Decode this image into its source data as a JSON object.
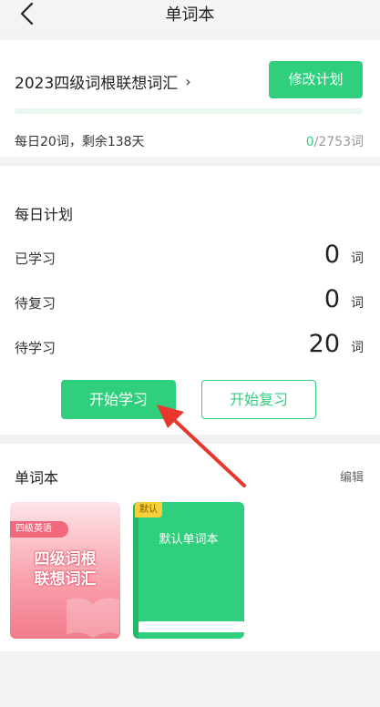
{
  "header": {
    "title": "单词本",
    "back_icon": "back-chevron-icon"
  },
  "plan": {
    "book_title": "2023四级词根联想词汇",
    "chevron": "›",
    "edit_button": "修改计划",
    "progress": 0,
    "description": "每日20词，剩余138天",
    "learned_count": "0",
    "total_count": "/2753词"
  },
  "daily": {
    "heading": "每日计划",
    "rows": [
      {
        "label": "已学习",
        "value": "0",
        "unit": "词"
      },
      {
        "label": "待复习",
        "value": "0",
        "unit": "词"
      },
      {
        "label": "待学习",
        "value": "20",
        "unit": "词"
      }
    ],
    "start_button": "开始学习",
    "review_button": "开始复习"
  },
  "books": {
    "heading": "单词本",
    "edit_label": "编辑",
    "items": [
      {
        "tag": "四级英语",
        "title_line1": "四级词根",
        "title_line2": "联想词汇"
      },
      {
        "badge": "默认",
        "title": "默认单词本"
      }
    ]
  },
  "colors": {
    "accent": "#2fcf7d",
    "pointer_arrow": "#e8372c",
    "book1_pink": "#f27c8c",
    "badge_yellow": "#f6cf3a"
  }
}
